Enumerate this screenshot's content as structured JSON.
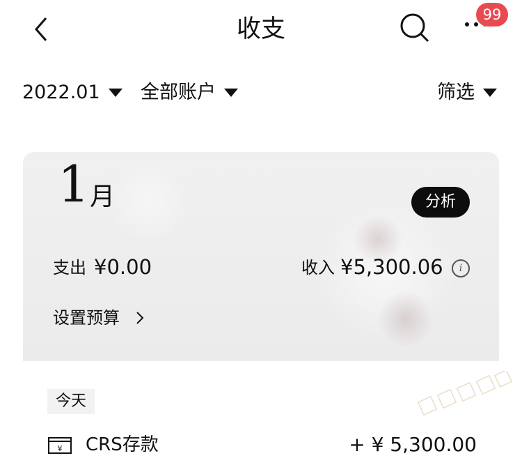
{
  "header": {
    "title": "收支",
    "badge_count": "99",
    "icons": [
      "back-icon",
      "search-icon",
      "more-icon"
    ]
  },
  "filters": {
    "period": "2022.01",
    "account": "全部账户",
    "filter": "筛选"
  },
  "summary": {
    "month_number": "1",
    "month_suffix": "月",
    "analyze_label": "分析",
    "expense_label": "支出",
    "expense_value": "¥0.00",
    "income_label": "收入",
    "income_value": "¥5,300.06",
    "budget_label": "设置预算"
  },
  "transactions": {
    "group_label": "今天",
    "items": [
      {
        "name": "CRS存款",
        "amount": "+ ¥ 5,300.00",
        "icon": "cash-icon"
      }
    ]
  },
  "colors": {
    "badge": "#e84a4f",
    "analyze_button": "#0d0d0d"
  }
}
